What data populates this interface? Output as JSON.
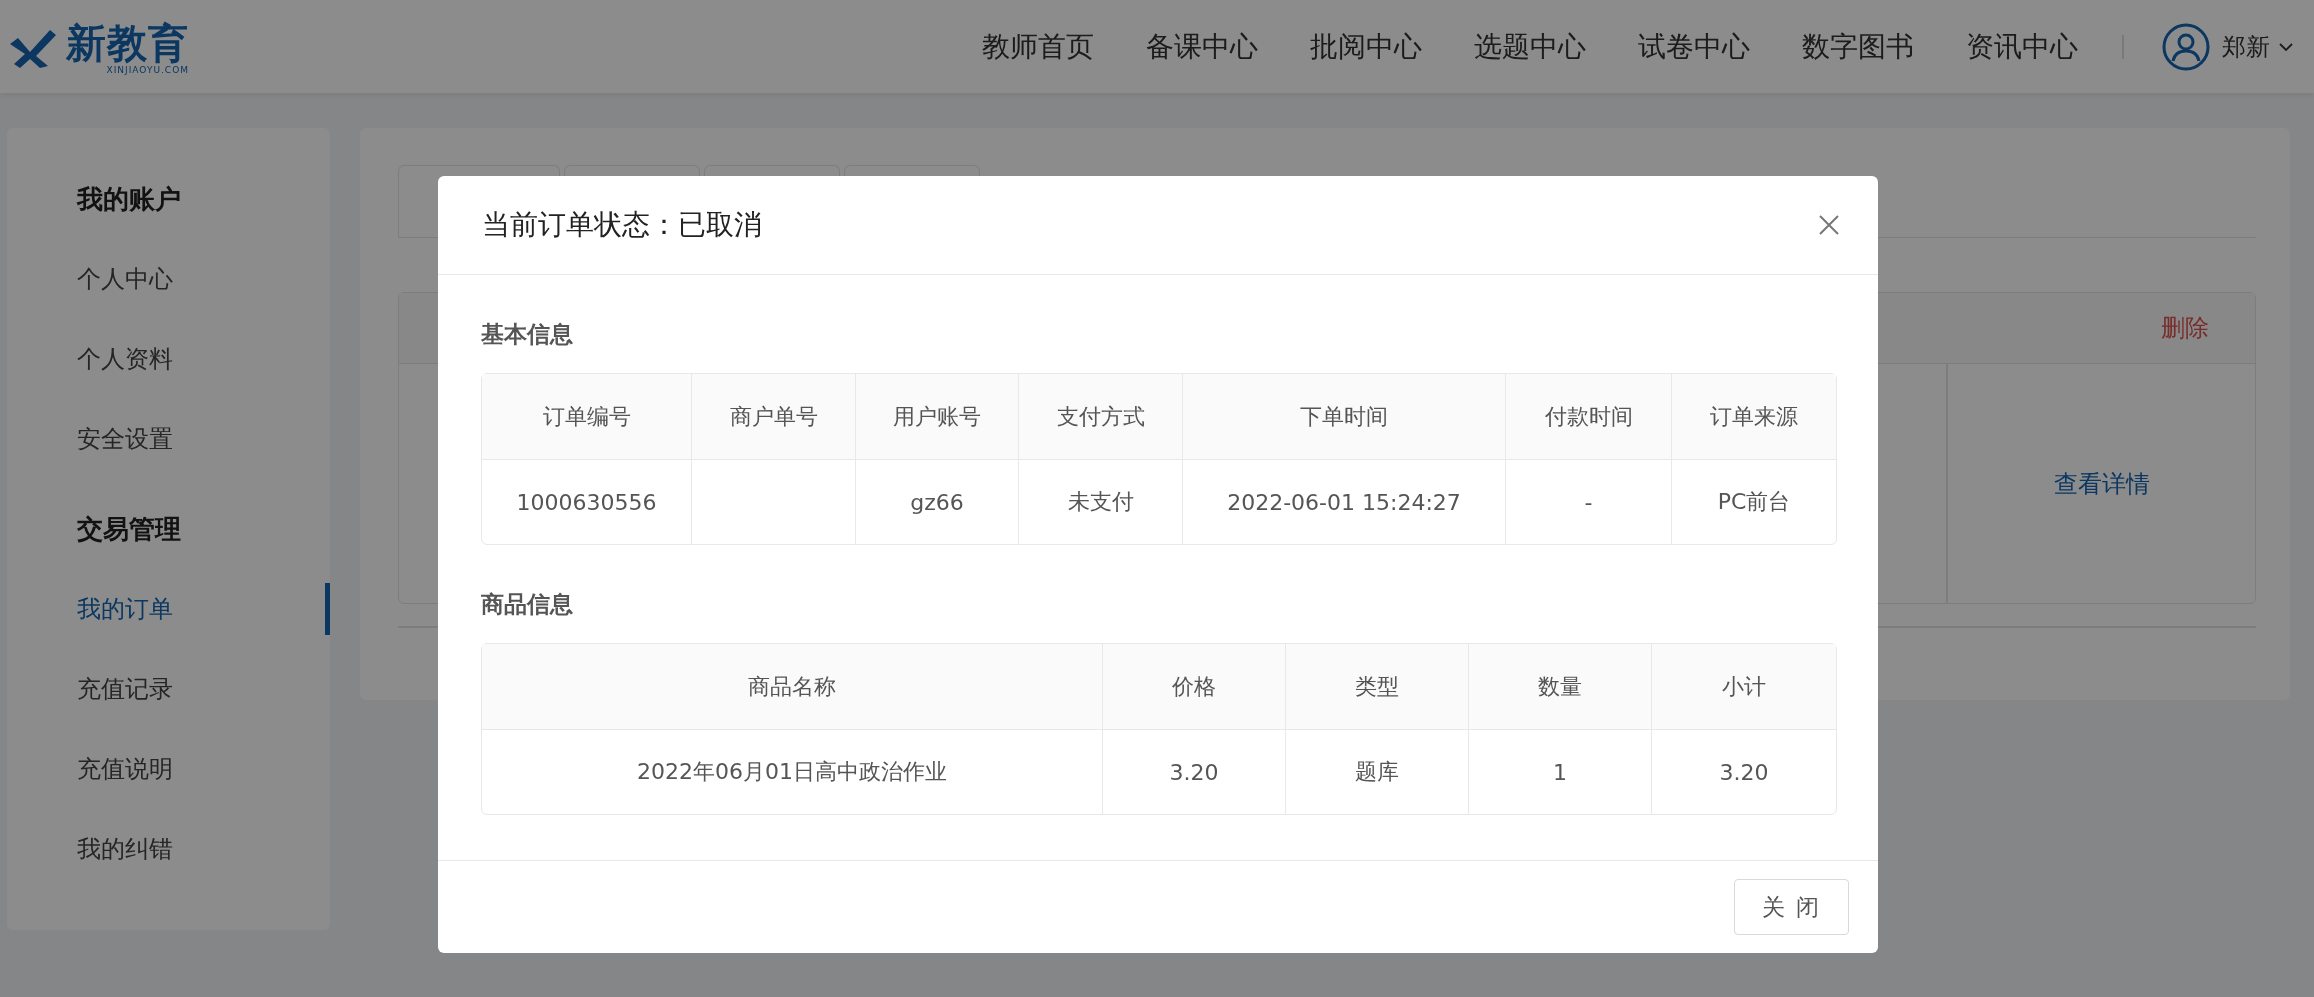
{
  "header": {
    "logo": {
      "text": "新教育",
      "subtext": "XINJIAOYU.COM"
    },
    "nav": [
      "教师首页",
      "备课中心",
      "批阅中心",
      "选题中心",
      "试卷中心",
      "数字图书",
      "资讯中心"
    ],
    "user": {
      "name": "郑新"
    }
  },
  "sidebar": {
    "sections": [
      {
        "title": "我的账户",
        "items": [
          {
            "label": "个人中心",
            "selected": false
          },
          {
            "label": "个人资料",
            "selected": false
          },
          {
            "label": "安全设置",
            "selected": false
          }
        ]
      },
      {
        "title": "交易管理",
        "items": [
          {
            "label": "我的订单",
            "selected": true
          },
          {
            "label": "充值记录",
            "selected": false
          },
          {
            "label": "充值说明",
            "selected": false
          },
          {
            "label": "我的纠错",
            "selected": false
          }
        ]
      }
    ]
  },
  "order_card": {
    "delete_link": "删除",
    "details_link": "查看详情"
  },
  "dialog": {
    "title": "当前订单状态：已取消",
    "sections": [
      {
        "title": "基本信息",
        "table": {
          "columns": [
            "订单编号",
            "商户单号",
            "用户账号",
            "支付方式",
            "下单时间",
            "付款时间",
            "订单来源"
          ],
          "rows": [
            [
              "1000630556",
              null,
              "gz66",
              "未支付",
              "2022-06-01 15:24:27",
              "-",
              "PC前台"
            ]
          ]
        }
      },
      {
        "title": "商品信息",
        "table": {
          "columns": [
            "商品名称",
            "价格",
            "类型",
            "数量",
            "小计"
          ],
          "rows": [
            [
              "2022年06月01日高中政治作业",
              "3.20",
              "题库",
              "1",
              "3.20"
            ]
          ]
        }
      }
    ],
    "buttons": [
      "关 闭"
    ]
  }
}
